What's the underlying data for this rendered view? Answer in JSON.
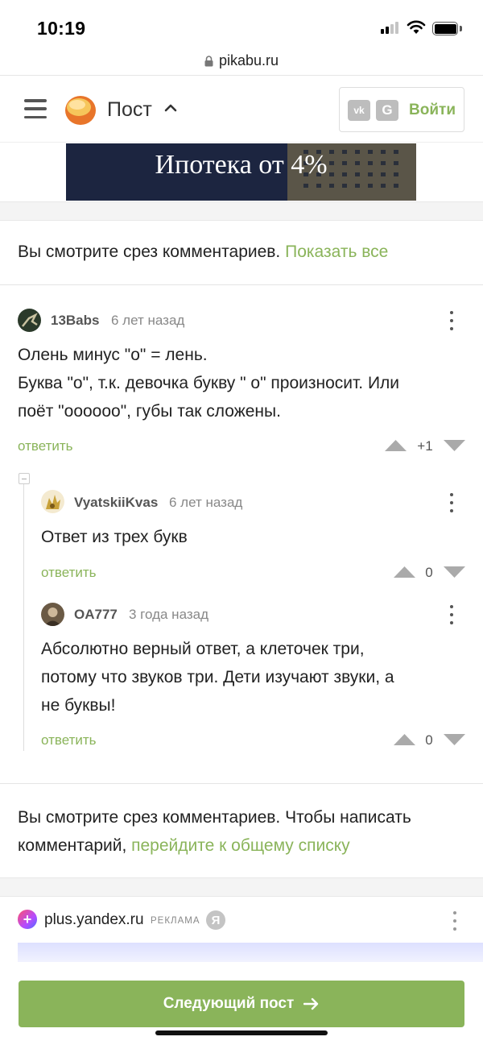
{
  "status_bar": {
    "time": "10:19"
  },
  "browser": {
    "url": "pikabu.ru"
  },
  "header": {
    "title": "Пост",
    "vk_label": "vk",
    "g_label": "G",
    "login_label": "Войти"
  },
  "banner": {
    "text": "Ипотека от 4%"
  },
  "slice_notice_top": {
    "text": "Вы смотрите срез комментариев. ",
    "link": "Показать все"
  },
  "comments": [
    {
      "author": "13Babs",
      "time_ago": "6 лет назад",
      "lines": [
        "Олень минус \"о\" = лень.",
        "Буква \"о\", т.к. девочка букву \" о\" произносит. Или",
        "поёт \"оооооо\", губы так сложены."
      ],
      "reply_label": "ответить",
      "score": "+1"
    },
    {
      "author": "VyatskiiKvas",
      "time_ago": "6 лет назад",
      "lines": [
        "Ответ из трех букв"
      ],
      "reply_label": "ответить",
      "score": "0"
    },
    {
      "author": "OA777",
      "time_ago": "3 года назад",
      "lines": [
        "Абсолютно верный ответ, а клеточек три,",
        "потому что звуков три. Дети изучают звуки, а",
        "не буквы!"
      ],
      "reply_label": "ответить",
      "score": "0"
    }
  ],
  "slice_notice_bottom": {
    "line1": "Вы смотрите срез комментариев. Чтобы написать",
    "line2_prefix": "комментарий, ",
    "link": "перейдите к общему списку"
  },
  "yandex_ad": {
    "url": "plus.yandex.ru",
    "label": "РЕКЛАМА",
    "ya": "Я"
  },
  "next_post": {
    "label": "Следующий пост",
    "arrow": "→"
  },
  "colors": {
    "accent_green": "#8ab45a"
  },
  "icons": [
    "signal-icon",
    "wifi-icon",
    "battery-icon",
    "lock-icon",
    "menu-icon",
    "pikabu-logo-icon",
    "chevron-up-icon",
    "vk-icon",
    "google-icon",
    "more-vertical-icon",
    "upvote-icon",
    "downvote-icon",
    "collapse-icon",
    "yandex-plus-icon",
    "yandex-icon",
    "arrow-right-icon"
  ]
}
